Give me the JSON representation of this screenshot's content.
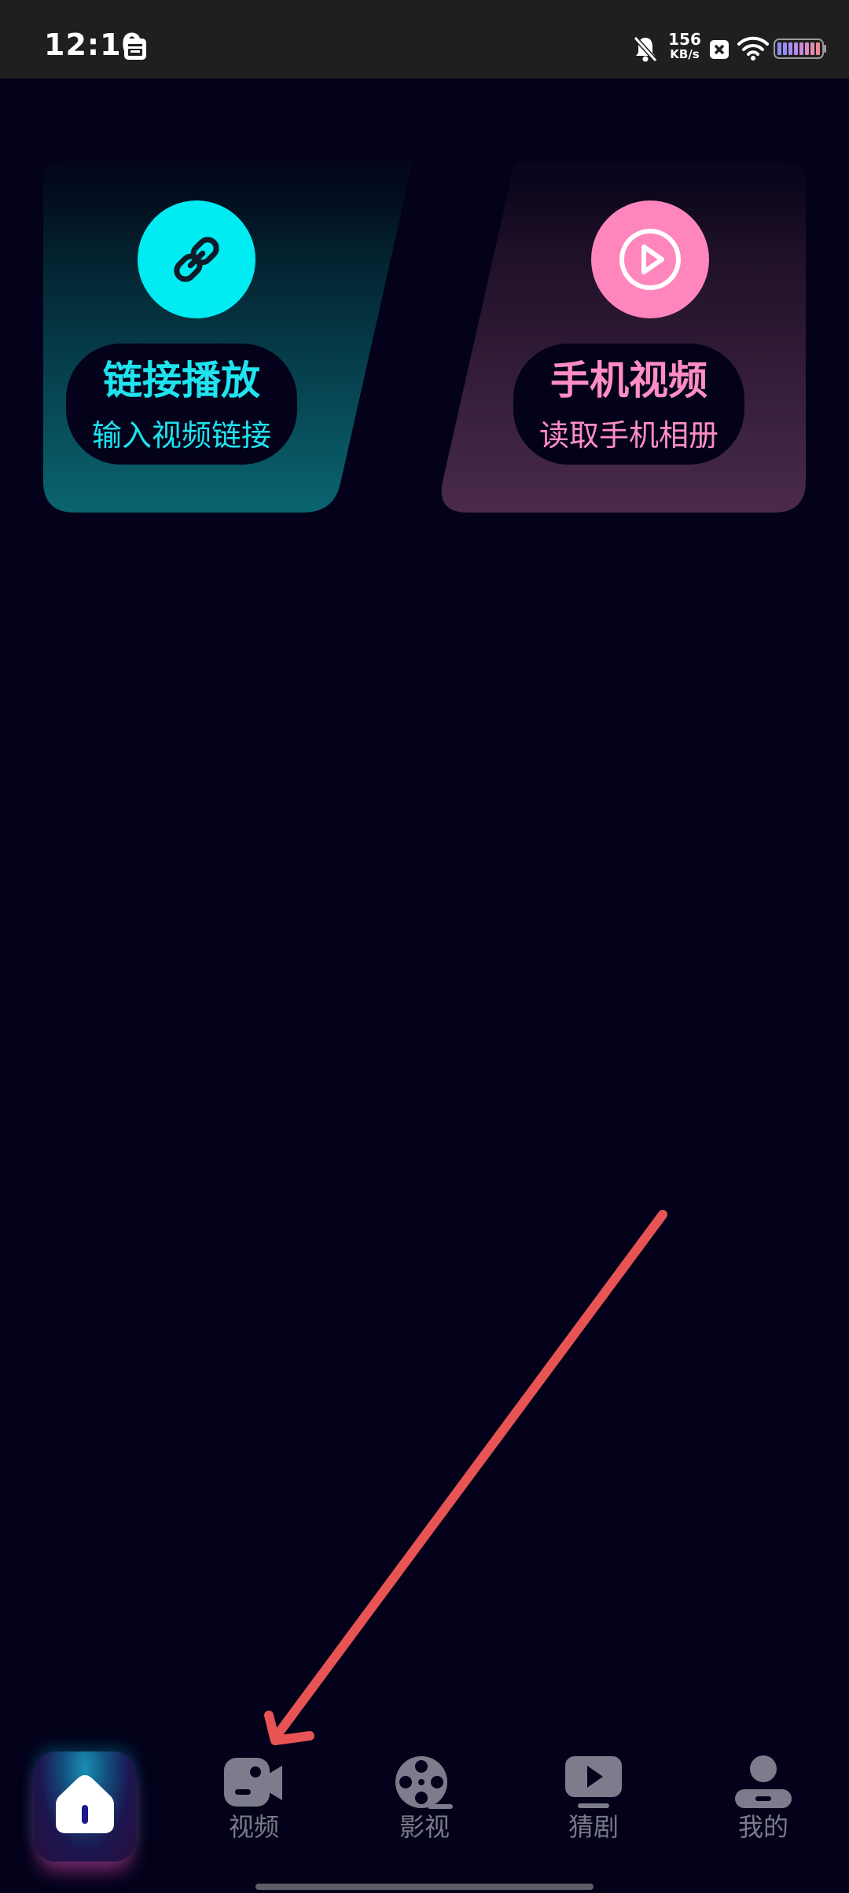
{
  "status_bar": {
    "time": "12:10",
    "net_speed_value": "156",
    "net_speed_unit": "KB/s",
    "icons": [
      "calendar-notification-icon",
      "bell-muted-icon",
      "sim-x-icon",
      "wifi-icon",
      "battery-icon"
    ]
  },
  "cards": {
    "link_play": {
      "title": "链接播放",
      "subtitle": "输入视频链接",
      "icon": "link-icon",
      "accent": "#00ecf2"
    },
    "phone_video": {
      "title": "手机视频",
      "subtitle": "读取手机相册",
      "icon": "play-circle-icon",
      "accent": "#ff86bd"
    }
  },
  "bottom_nav": {
    "items": [
      {
        "label": "",
        "icon": "home-icon",
        "active": true
      },
      {
        "label": "视频",
        "icon": "video-camera-icon"
      },
      {
        "label": "影视",
        "icon": "film-reel-icon"
      },
      {
        "label": "猜剧",
        "icon": "play-screen-icon"
      },
      {
        "label": "我的",
        "icon": "user-icon"
      }
    ]
  },
  "colors": {
    "background": "#03021a",
    "status_bar": "#1f1f1f",
    "nav_inactive": "#7a7989",
    "annotation_arrow": "#e85454"
  }
}
